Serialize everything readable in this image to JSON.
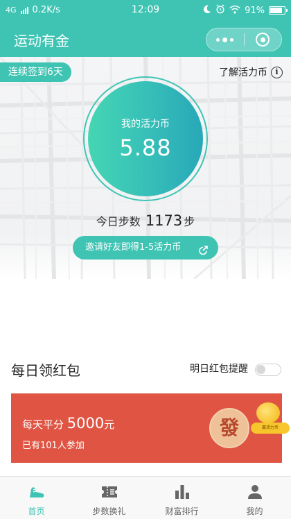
{
  "status_bar": {
    "network": "4G",
    "speed": "0.2K/s",
    "time": "12:09",
    "battery": "91%",
    "battery_level": 0.91,
    "icons": [
      "signal-icon",
      "moon-icon",
      "alarm-icon",
      "wifi-icon",
      "battery-icon"
    ]
  },
  "nav": {
    "title": "运动有金",
    "capsule_icons": [
      "more-dots-icon",
      "close-target-icon"
    ]
  },
  "hero": {
    "checkin_badge": "连续签到6天",
    "learn_link": "了解活力币",
    "coin_label": "我的活力币",
    "coin_value": "5.88",
    "steps_prefix": "今日步数",
    "steps_value": "1173",
    "steps_unit": "步",
    "invite_label": "邀请好友即得1-5活力币"
  },
  "daily": {
    "title": "每日领红包",
    "reminder_label": "明日红包提醒",
    "reminder_on": false,
    "card_prefix": "每天平分",
    "card_amount": "5000",
    "card_unit": "元",
    "card_sub": "已有101人参加",
    "fa_char": "發",
    "bubble_text": "赢活力币"
  },
  "tabs": [
    {
      "label": "首页",
      "icon": "shoe-icon",
      "active": true
    },
    {
      "label": "步数换礼",
      "icon": "ticket-icon",
      "active": false
    },
    {
      "label": "财富排行",
      "icon": "bar-chart-icon",
      "active": false
    },
    {
      "label": "我的",
      "icon": "user-icon",
      "active": false
    }
  ],
  "colors": {
    "primary": "#3fc4b4",
    "red_card": "#df5443",
    "inactive_icon": "#666666"
  }
}
